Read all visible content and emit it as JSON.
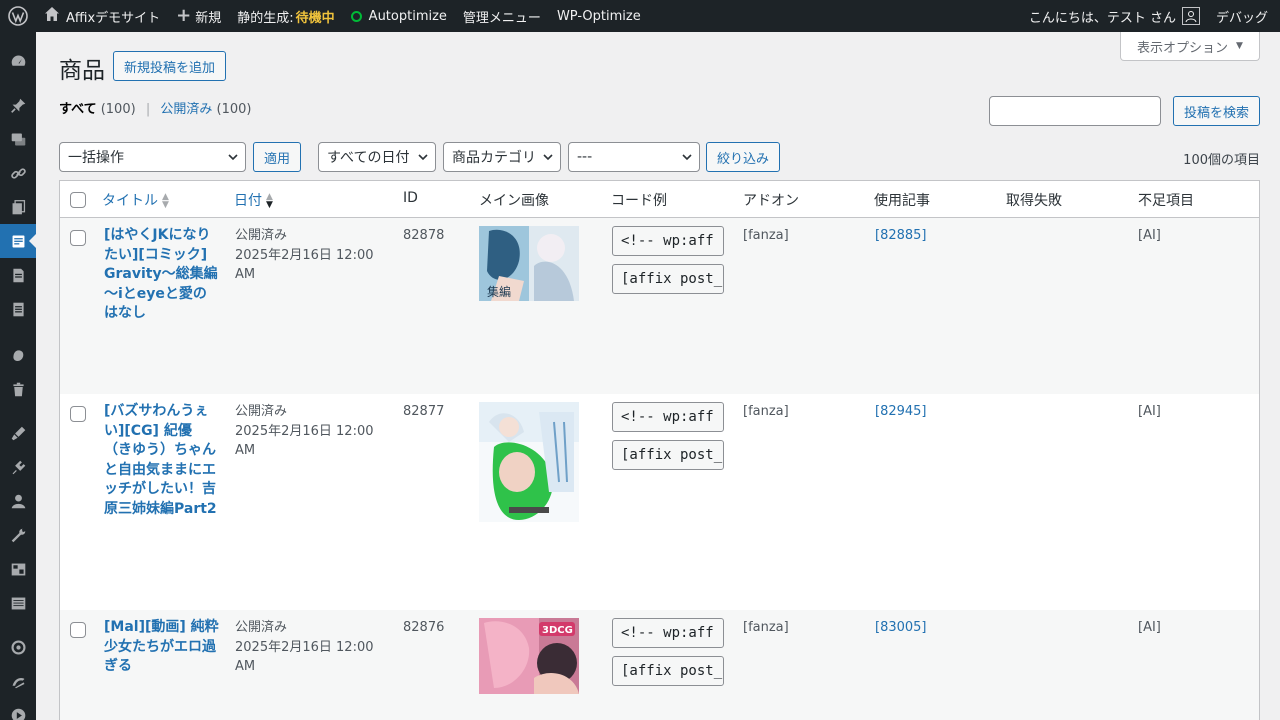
{
  "adminbar": {
    "site_name": "Affixデモサイト",
    "new_label": "新規",
    "static_label": "静的生成:",
    "static_status": "待機中",
    "autoptimize": "Autoptimize",
    "admin_menu": "管理メニュー",
    "wp_optimize": "WP-Optimize",
    "greeting": "こんにちは、テスト さん",
    "debug": "デバッグ"
  },
  "screen_options": "表示オプション",
  "page": {
    "title": "商品",
    "add_new": "新規投稿を追加"
  },
  "views": {
    "all_label": "すべて",
    "all_count": "(100)",
    "published_label": "公開済み",
    "published_count": "(100)",
    "separator": "|"
  },
  "search": {
    "value": "",
    "button": "投稿を検索"
  },
  "filters": {
    "bulk_action": "一括操作",
    "apply": "適用",
    "dates": "すべての日付",
    "category": "商品カテゴリ",
    "extra": "---",
    "filter_button": "絞り込み",
    "items_count": "100個の項目"
  },
  "columns": {
    "title": "タイトル",
    "date": "日付",
    "id": "ID",
    "image": "メイン画像",
    "code": "コード例",
    "addon": "アドオン",
    "used": "使用記事",
    "failed": "取得失敗",
    "missing": "不足項目"
  },
  "rows": [
    {
      "title": "[はやくJKになりたい][コミック] Gravity～総集編～iとeyeと愛のはなし",
      "status": "公開済み",
      "date": "2025年2月16日 12:00 AM",
      "id": "82878",
      "code1": "<!-- wp:aff",
      "code2": "[affix post_",
      "addon": "[fanza]",
      "used": "[82885]",
      "failed": "",
      "missing": "[AI]"
    },
    {
      "title": "[バズサわんうぇい][CG] 紀優（きゆう）ちゃんと自由気ままにエッチがしたい！吉原三姉妹編Part2",
      "status": "公開済み",
      "date": "2025年2月16日 12:00 AM",
      "id": "82877",
      "code1": "<!-- wp:aff",
      "code2": "[affix post_",
      "addon": "[fanza]",
      "used": "[82945]",
      "failed": "",
      "missing": "[AI]"
    },
    {
      "title": "[Mal][動画] 純粋少女たちがエロ過ぎる",
      "status": "公開済み",
      "date": "2025年2月16日 12:00 AM",
      "id": "82876",
      "code1": "<!-- wp:aff",
      "code2": "[affix post_",
      "addon": "[fanza]",
      "used": "[83005]",
      "failed": "",
      "missing": "[AI]"
    }
  ]
}
